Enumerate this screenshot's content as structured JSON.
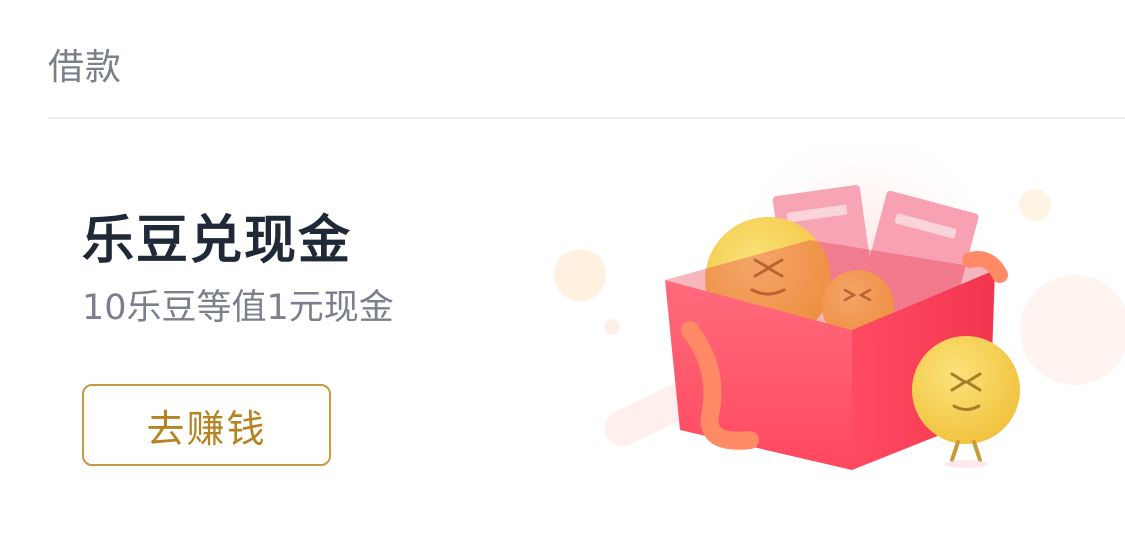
{
  "section": {
    "label": "借款"
  },
  "promo": {
    "title": "乐豆兑现金",
    "subtitle": "10乐豆等值1元现金",
    "button_label": "去赚钱"
  },
  "illustration": {
    "icon": "gift-box-with-coins",
    "colors": {
      "box": "#ff4d63",
      "coin": "#f4c647",
      "ribbon": "#ff8a65",
      "voucher": "#f7a0b2"
    }
  }
}
